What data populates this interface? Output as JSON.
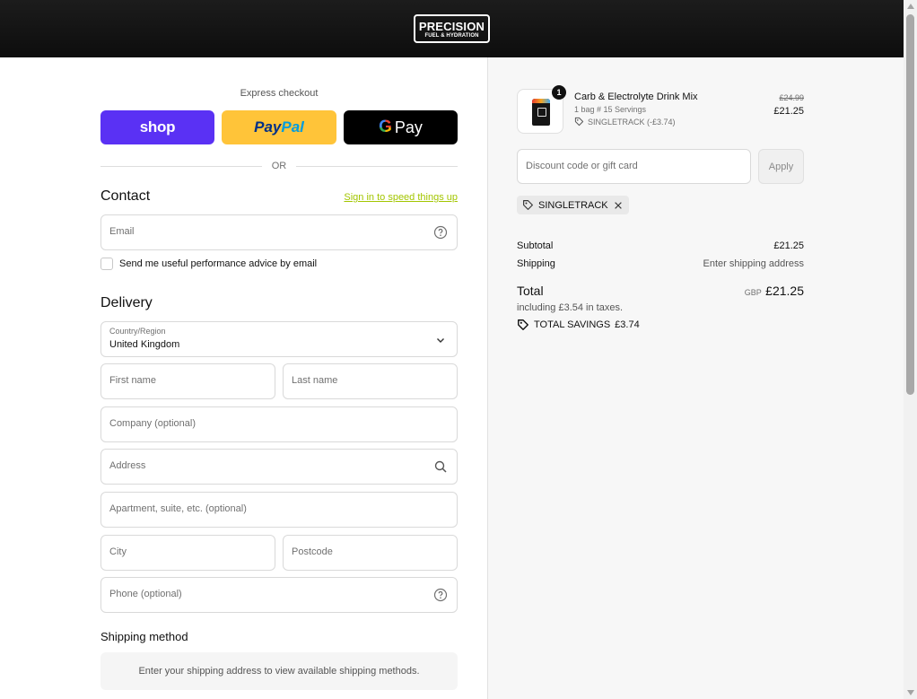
{
  "brand": {
    "line1": "PRECISION",
    "line2": "FUEL & HYDRATION"
  },
  "express": {
    "title": "Express checkout",
    "shop_label": "shop",
    "paypal_part1": "Pay",
    "paypal_part2": "Pal",
    "gpay_g": "G",
    "gpay_label": "Pay",
    "or_label": "OR"
  },
  "contact": {
    "heading": "Contact",
    "sign_in_link": "Sign in to speed things up",
    "email_placeholder": "Email",
    "newsletter_label": "Send me useful performance advice by email"
  },
  "delivery": {
    "heading": "Delivery",
    "country_label": "Country/Region",
    "country_value": "United Kingdom",
    "first_name": "First name",
    "last_name": "Last name",
    "company": "Company (optional)",
    "address": "Address",
    "apartment": "Apartment, suite, etc. (optional)",
    "city": "City",
    "postcode": "Postcode",
    "phone": "Phone (optional)"
  },
  "shipping": {
    "heading": "Shipping method",
    "message": "Enter your shipping address to view available shipping methods."
  },
  "cart": {
    "product_name": "Carb & Electrolyte Drink Mix",
    "product_variant": "1 bag # 15 Servings",
    "product_discount": "SINGLETRACK (-£3.74)",
    "quantity": "1",
    "old_price": "£24.99",
    "price": "£21.25"
  },
  "discount": {
    "placeholder": "Discount code or gift card",
    "apply_label": "Apply",
    "applied_code": "SINGLETRACK"
  },
  "summary": {
    "subtotal_label": "Subtotal",
    "subtotal_value": "£21.25",
    "shipping_label": "Shipping",
    "shipping_value": "Enter shipping address",
    "total_label": "Total",
    "currency": "GBP",
    "total_value": "£21.25",
    "tax_note": "including £3.54 in taxes.",
    "savings_label": "TOTAL SAVINGS",
    "savings_value": "£3.74"
  },
  "colors": {
    "shop": "#5a31f4",
    "paypal": "#ffc439",
    "link": "#a3c600"
  }
}
